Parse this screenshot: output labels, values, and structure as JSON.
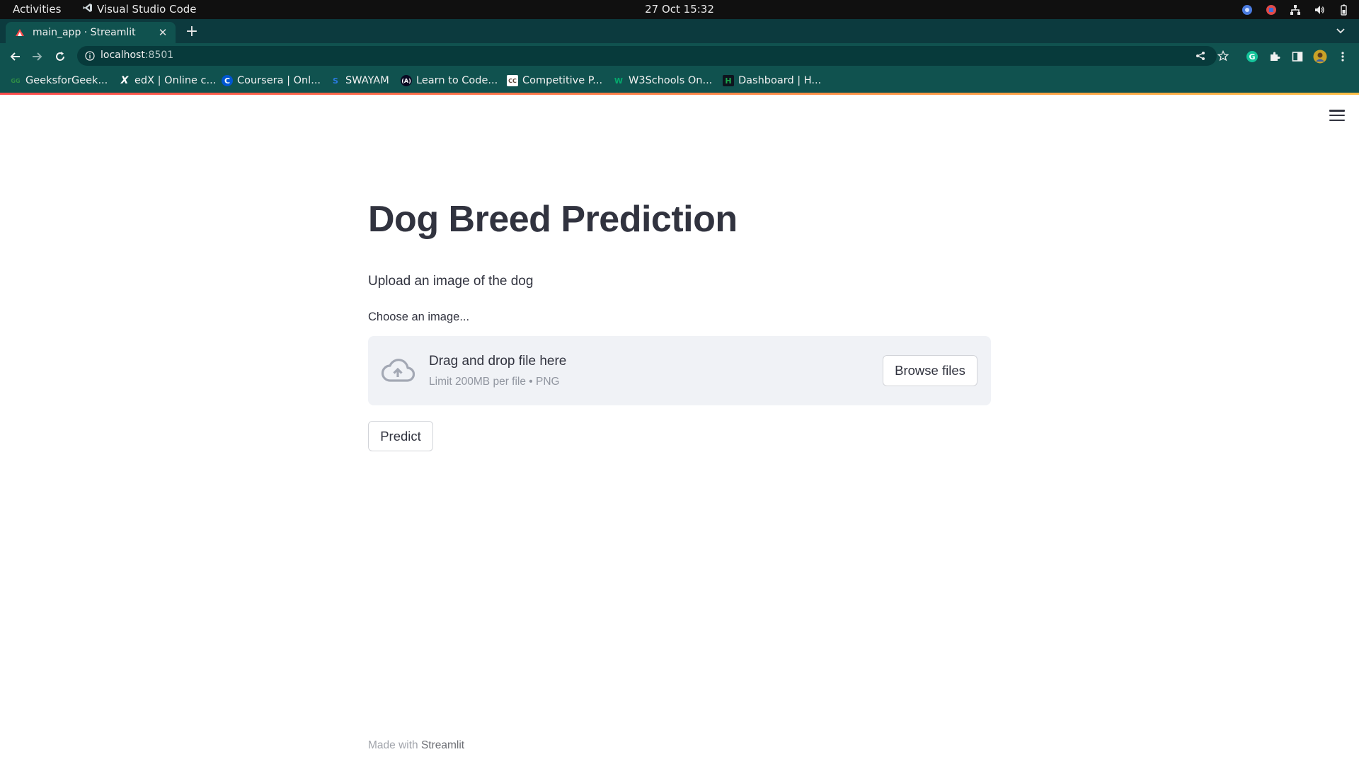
{
  "system_bar": {
    "activities": "Activities",
    "app_name": "Visual Studio Code",
    "clock": "27 Oct  15:32"
  },
  "browser": {
    "tab_title": "main_app · Streamlit",
    "url_host": "localhost",
    "url_port": ":8501",
    "bookmarks": [
      {
        "label": "GeeksforGeek...",
        "icon": "geeksforgeeks-icon",
        "icon_text": "GG",
        "color": "#2f8d46"
      },
      {
        "label": "edX | Online c...",
        "icon": "edx-icon",
        "icon_text": "X",
        "color": "#ffffff"
      },
      {
        "label": "Coursera | Onl...",
        "icon": "coursera-icon",
        "icon_text": "C",
        "color": "#0056d2"
      },
      {
        "label": "SWAYAM",
        "icon": "swayam-icon",
        "icon_text": "S",
        "color": "#2a7ae2"
      },
      {
        "label": "Learn to Code...",
        "icon": "freecodecamp-icon",
        "icon_text": "(A)",
        "color": "#0a0a23"
      },
      {
        "label": "Competitive P...",
        "icon": "codechef-icon",
        "icon_text": "CC",
        "color": "#5b4638"
      },
      {
        "label": "W3Schools On...",
        "icon": "w3schools-icon",
        "icon_text": "W",
        "color": "#04aa6d"
      },
      {
        "label": "Dashboard | H...",
        "icon": "hackerrank-icon",
        "icon_text": "H",
        "color": "#000000"
      }
    ]
  },
  "app": {
    "title": "Dog Breed Prediction",
    "subtitle": "Upload an image of the dog",
    "uploader": {
      "label": "Choose an image...",
      "drag_text": "Drag and drop file here",
      "limit_text": "Limit 200MB per file • PNG",
      "browse_label": "Browse files"
    },
    "predict_label": "Predict",
    "footer": {
      "prefix": "Made with ",
      "brand": "Streamlit"
    }
  },
  "colors": {
    "chrome_frame": "#0c3a3e",
    "chrome_toolbar": "#10524f",
    "streamlit_text": "#31333f",
    "dropzone_bg": "#f0f2f6",
    "accent_red": "#ff4b4b"
  }
}
